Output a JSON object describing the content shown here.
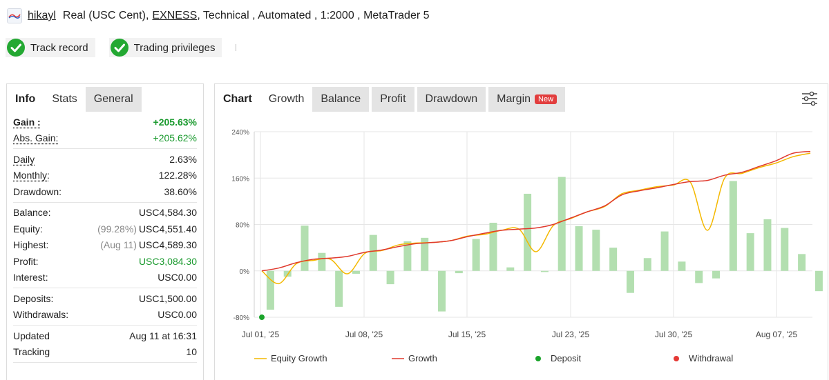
{
  "header": {
    "username": "hikayl",
    "account_type": "Real (USC Cent),",
    "broker": "EXNESS",
    "details": ", Technical , Automated , 1:2000 , MetaTrader 5"
  },
  "badges": [
    "Track record",
    "Trading privileges"
  ],
  "left_tabs": [
    "Info",
    "Stats",
    "General"
  ],
  "stats": [
    [
      {
        "label": "Gain :",
        "value": "+205.63%"
      },
      {
        "label": "Abs. Gain:",
        "value": "+205.62%"
      }
    ],
    [
      {
        "label": "Daily",
        "value": "2.63%"
      },
      {
        "label": "Monthly:",
        "value": "122.28%"
      },
      {
        "label": "Drawdown:",
        "value": "38.60%"
      }
    ],
    [
      {
        "label": "Balance:",
        "value": "USC4,584.30"
      },
      {
        "label": "Equity:",
        "prefix": "(99.28%)",
        "value": "USC4,551.40"
      },
      {
        "label": "Highest:",
        "prefix": "(Aug 11)",
        "value": "USC4,589.30"
      },
      {
        "label": "Profit:",
        "value": "USC3,084.30"
      },
      {
        "label": "Interest:",
        "value": "USC0.00"
      }
    ],
    [
      {
        "label": "Deposits:",
        "value": "USC1,500.00"
      },
      {
        "label": "Withdrawals:",
        "value": "USC0.00"
      }
    ],
    [
      {
        "label": "Updated",
        "value": "Aug 11 at 16:31"
      },
      {
        "label": "Tracking",
        "value": "10"
      }
    ]
  ],
  "chart_tabs": [
    "Chart",
    "Growth",
    "Balance",
    "Profit",
    "Drawdown",
    "Margin"
  ],
  "new_badge": "New",
  "colors": {
    "equity": "#f4b800",
    "growth": "#e03a2e",
    "bars": "#b3dfb0",
    "deposit": "#1aa32a",
    "withdrawal": "#e53935"
  },
  "chart_data": {
    "type": "line",
    "xlabels": [
      "Jul 01, '25",
      "Jul 08, '25",
      "Jul 15, '25",
      "Jul 23, '25",
      "Jul 30, '25",
      "Aug 07, '25"
    ],
    "ylabels": [
      "240%",
      "160%",
      "80%",
      "0%",
      "-80%"
    ],
    "ylim": [
      -80,
      240
    ],
    "bars": [
      -67,
      -10,
      78,
      31,
      -62,
      -5,
      62,
      -23,
      51,
      57,
      -70,
      -4,
      55,
      83,
      6,
      133,
      -2,
      162,
      77,
      71,
      40,
      -38,
      22,
      68,
      16,
      -21,
      -13,
      155,
      65,
      89,
      74,
      29,
      -35
    ],
    "series": [
      {
        "name": "Equity Growth",
        "values": [
          0,
          -22,
          12,
          18,
          20,
          -5,
          30,
          35,
          45,
          48,
          49,
          52,
          60,
          63,
          70,
          72,
          33,
          78,
          90,
          102,
          111,
          133,
          139,
          145,
          148,
          153,
          70,
          160,
          168,
          178,
          186,
          197,
          203
        ]
      },
      {
        "name": "Growth",
        "values": [
          0,
          5,
          14,
          20,
          22,
          25,
          32,
          36,
          42,
          47,
          49,
          52,
          59,
          65,
          70,
          72,
          74,
          80,
          91,
          102,
          112,
          131,
          138,
          143,
          149,
          154,
          156,
          165,
          170,
          180,
          190,
          203,
          206
        ]
      }
    ],
    "deposit_point": {
      "index": 0,
      "value": -80
    },
    "legend": [
      "Equity Growth",
      "Growth",
      "Deposit",
      "Withdrawal"
    ]
  }
}
